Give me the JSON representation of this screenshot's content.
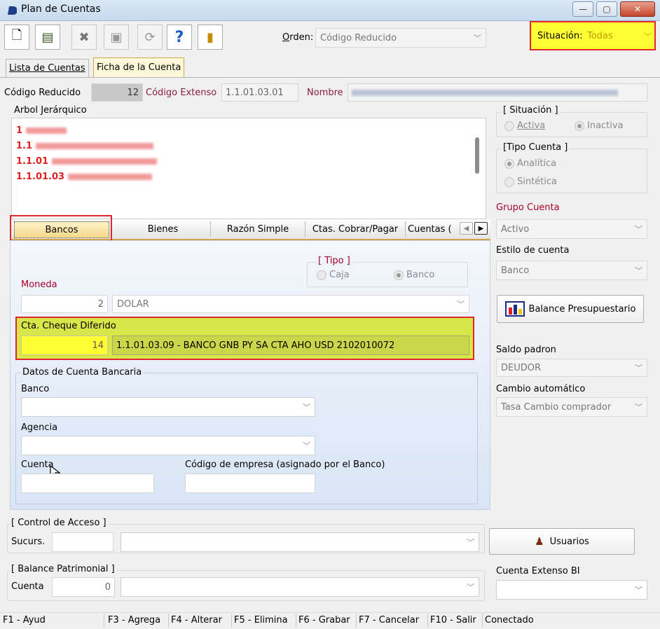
{
  "window": {
    "title": "Plan de Cuentas",
    "minimize": "—",
    "maximize": "▢",
    "close": "✕"
  },
  "toolbar": {
    "new_icon": "🗋",
    "copy_icon": "▤",
    "delete_icon": "✖",
    "save_icon": "▣",
    "refresh_icon": "⟳",
    "help_icon": "?",
    "exit_icon": "▮",
    "orden_label": "Orden:",
    "orden_value": "Código Reducido",
    "situacion_label": "Situación:",
    "situacion_value": "Todas"
  },
  "tabs": {
    "lista": "Lista de Cuentas",
    "ficha": "Ficha de la Cuenta"
  },
  "header": {
    "codigo_reducido_label": "Código Reducido",
    "codigo_reducido_value": "12",
    "codigo_extenso_label": "Código Extenso",
    "codigo_extenso_value": "1.1.01.03.01",
    "nombre_label": "Nombre"
  },
  "tree": {
    "label": "Arbol Jerárquico",
    "items": [
      "1",
      "1.1",
      "1.1.01",
      "1.1.01.03"
    ]
  },
  "situacion": {
    "title": "[ Situación ]",
    "activa": "Activa",
    "inactiva": "Inactiva"
  },
  "tipo_cuenta": {
    "title": "[Tipo Cuenta ]",
    "analitica": "Analítica",
    "sintetica": "Sintética"
  },
  "grupo_cuenta": {
    "label": "Grupo Cuenta",
    "value": "Activo"
  },
  "estilo_cuenta": {
    "label": "Estilo de cuenta",
    "value": "Banco"
  },
  "balance_presupuestario": {
    "label": "Balance Presupuestario"
  },
  "saldo_padron": {
    "label": "Saldo padron",
    "value": "DEUDOR"
  },
  "cambio_automatico": {
    "label": "Cambio automático",
    "value": "Tasa Cambio comprador"
  },
  "subtabs": [
    "Bancos",
    "Bienes",
    "Razón Simple",
    "Ctas. Cobrar/Pagar",
    "Cuentas ("
  ],
  "bancos": {
    "tipo_title": "[ Tipo ]",
    "caja": "Caja",
    "banco": "Banco",
    "moneda_label": "Moneda",
    "moneda_code": "2",
    "moneda_value": "DOLAR",
    "cheque_label": "Cta. Cheque Diferido",
    "cheque_code": "14",
    "cheque_value": "1.1.01.03.09 - BANCO GNB PY SA CTA AHO USD 2102010072",
    "datos_title": "Datos de Cuenta Bancaria",
    "banco_label": "Banco",
    "agencia_label": "Agencia",
    "cuenta_label": "Cuenta",
    "codigo_empresa_label": "Código de empresa (asignado por el Banco)"
  },
  "control_acceso": {
    "title": "[ Control de Acceso ]",
    "sucurs_label": "Sucurs.",
    "usuarios_button": "Usuarios"
  },
  "balance_patrimonial": {
    "title": "[ Balance Patrimonial ]",
    "cuenta_label": "Cuenta",
    "cuenta_value": "0"
  },
  "cuenta_extenso_bi": {
    "label": "Cuenta Extenso BI"
  },
  "statusbar": {
    "f1": "F1 - Ayud",
    "f3": "F3 - Agrega",
    "f4": "F4 - Alterar",
    "f5": "F5 - Elimina",
    "f6": "F6 - Grabar",
    "f7": "F7 - Cancelar",
    "f10": "F10 - Salir",
    "status": "Conectado"
  },
  "colors": {
    "accent_red": "#a8002b",
    "highlight_yellow": "#ffff33",
    "cheque_bg": "#d8e64a",
    "tree_red": "#e02020"
  }
}
